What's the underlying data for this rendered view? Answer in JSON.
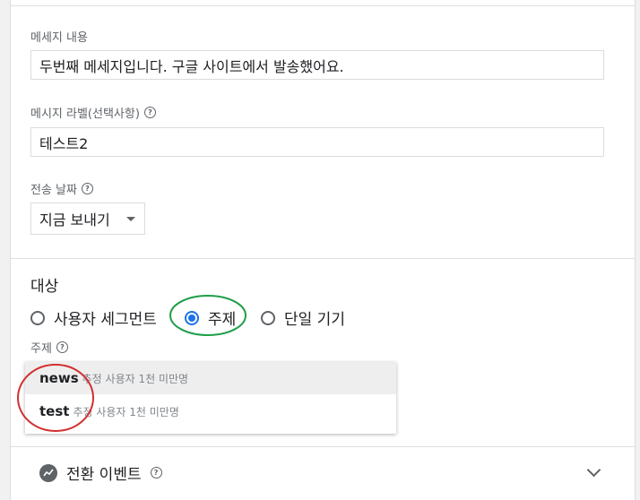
{
  "message": {
    "content_label": "메세지 내용",
    "content_value": "두번째 메세지입니다. 구글 사이트에서 발송했어요.",
    "label_label": "메시지 라벨(선택사항)",
    "label_value": "테스트2",
    "date_label": "전송 날짜",
    "date_value": "지금 보내기"
  },
  "target": {
    "title": "대상",
    "options": [
      {
        "label": "사용자 세그먼트",
        "selected": false
      },
      {
        "label": "주제",
        "selected": true
      },
      {
        "label": "단일 기기",
        "selected": false
      }
    ],
    "topic_label": "주제",
    "topics": [
      {
        "name": "news",
        "meta": "추정 사용자 1천 미만명"
      },
      {
        "name": "test",
        "meta": "추정 사용자 1천 미만명"
      }
    ]
  },
  "conversion": {
    "label": "전환 이벤트",
    "icon": "trending-icon"
  },
  "colors": {
    "accent": "#1a73e8",
    "annotation_green": "#1e9e48",
    "annotation_red": "#d32f2f"
  }
}
